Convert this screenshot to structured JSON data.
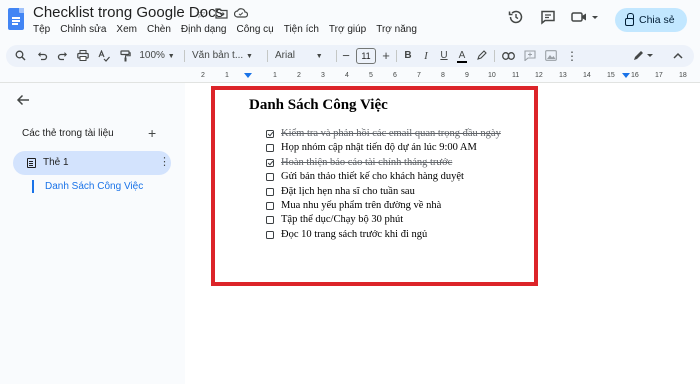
{
  "window": {
    "doc_title": "Checklist trong Google Docs",
    "title_icons": [
      "star-icon",
      "move-folder-icon",
      "cloud-saved-icon"
    ]
  },
  "menu": [
    "Tệp",
    "Chỉnh sửa",
    "Xem",
    "Chèn",
    "Định dạng",
    "Công cụ",
    "Tiện ích",
    "Trợ giúp",
    "Trợ năng"
  ],
  "header_actions": {
    "icons": [
      "history-icon",
      "comment-icon",
      "meet-icon"
    ],
    "share_label": "Chia sẻ"
  },
  "toolbar": {
    "zoom": "100%",
    "style": "Văn bản t...",
    "font": "Arial",
    "font_size": "11",
    "bold": "B",
    "italic": "I",
    "underline": "U",
    "text_color": "A"
  },
  "ruler": {
    "ticks": [
      "2",
      "1",
      "1",
      "2",
      "3",
      "4",
      "5",
      "6",
      "7",
      "8",
      "9",
      "10",
      "11",
      "12",
      "13",
      "14",
      "15",
      "16",
      "17",
      "18"
    ]
  },
  "sidebar": {
    "heading": "Các thẻ trong tài liệu",
    "tab_label": "Thẻ 1",
    "outline_item": "Danh Sách Công Việc"
  },
  "document": {
    "title": "Danh Sách Công Việc",
    "items": [
      {
        "text": "Kiểm tra và phản hồi các email quan trọng đầu ngày",
        "checked": true
      },
      {
        "text": "Họp nhóm cập nhật tiến độ dự án lúc 9:00 AM",
        "checked": false
      },
      {
        "text": "Hoàn thiện báo cáo tài chính tháng trước",
        "checked": true
      },
      {
        "text": "Gửi bản thảo thiết kế cho khách hàng duyệt",
        "checked": false
      },
      {
        "text": "Đặt lịch hẹn nha sĩ cho tuần sau",
        "checked": false
      },
      {
        "text": "Mua nhu yếu phẩm trên đường về nhà",
        "checked": false
      },
      {
        "text": "Tập thể dục/Chạy bộ 30 phút",
        "checked": false
      },
      {
        "text": "Đọc 10 trang sách trước khi đi ngủ",
        "checked": false
      }
    ]
  },
  "colors": {
    "accent": "#1a73e8",
    "share_bg": "#c2e7ff",
    "highlight_frame": "#dc2429",
    "active_tab_bg": "#d3e3fd"
  }
}
